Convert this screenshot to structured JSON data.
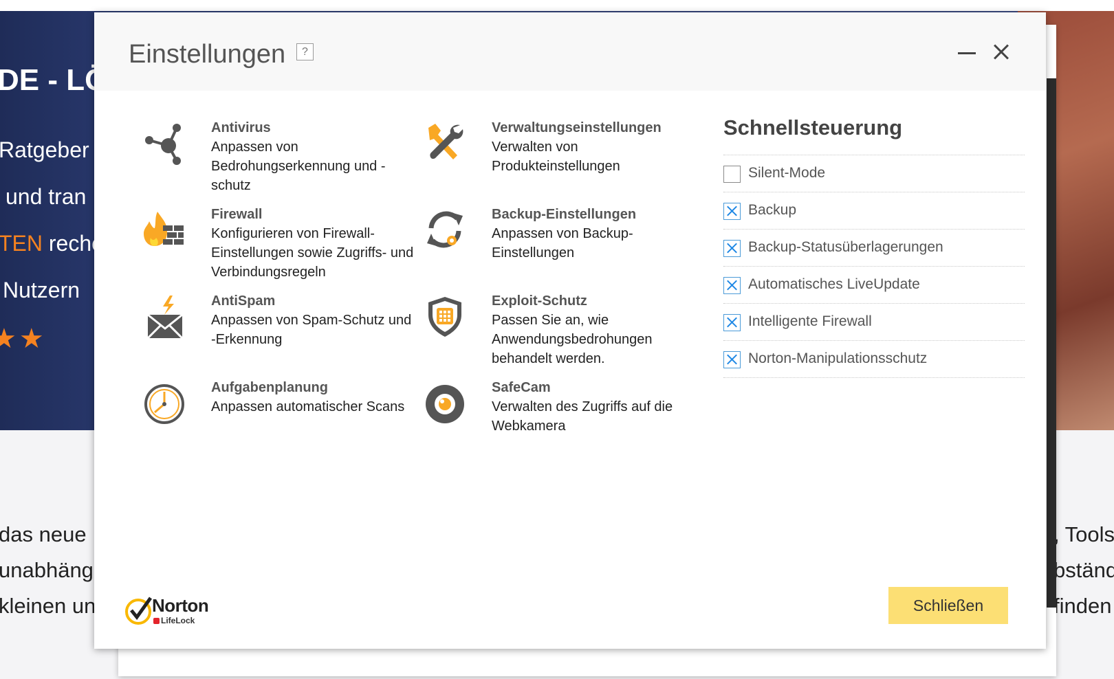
{
  "background": {
    "hero_title": "DE - LÖ",
    "hero_line1": "Ratgeber",
    "hero_line2": "und tran",
    "hero_line3_accent": "TEN",
    "hero_line3_rest": " reche",
    "hero_line4": "Nutzern",
    "stars": "★★",
    "body_left": [
      "das neue I",
      "unabhängi",
      "kleinen un"
    ],
    "body_right": [
      ", Tools",
      "bständ",
      "finden"
    ]
  },
  "dialog": {
    "title": "Einstellungen",
    "help_label": "?",
    "minimize_label": "",
    "close_label": ""
  },
  "settings": [
    {
      "title": "Antivirus",
      "description": "Anpassen von Bedrohungserkennung und -schutz",
      "icon": "antivirus-icon"
    },
    {
      "title": "Firewall",
      "description": "Konfigurieren von Firewall-Einstellungen sowie Zugriffs- und Verbindungsregeln",
      "icon": "firewall-icon"
    },
    {
      "title": "AntiSpam",
      "description": "Anpassen von Spam-Schutz und -Erkennung",
      "icon": "antispam-icon"
    },
    {
      "title": "Aufgabenplanung",
      "description": "Anpassen automatischer Scans",
      "icon": "clock-icon"
    },
    {
      "title": "Verwaltungseinstellungen",
      "description": "Verwalten von Produkteinstellungen",
      "icon": "tools-icon"
    },
    {
      "title": "Backup-Einstellungen",
      "description": "Anpassen von Backup-Einstellungen",
      "icon": "backup-icon"
    },
    {
      "title": "Exploit-Schutz",
      "description": "Passen Sie an, wie Anwendungsbedrohungen behandelt werden.",
      "icon": "shield-icon"
    },
    {
      "title": "SafeCam",
      "description": "Verwalten des Zugriffs auf die Webkamera",
      "icon": "webcam-icon"
    }
  ],
  "quick_controls": {
    "title": "Schnellsteuerung",
    "items": [
      {
        "label": "Silent-Mode",
        "checked": false
      },
      {
        "label": "Backup",
        "checked": true
      },
      {
        "label": "Backup-Statusüberlagerungen",
        "checked": true
      },
      {
        "label": "Automatisches LiveUpdate",
        "checked": true
      },
      {
        "label": "Intelligente Firewall",
        "checked": true
      },
      {
        "label": "Norton-Manipulationsschutz",
        "checked": true
      }
    ]
  },
  "footer": {
    "close_button_label": "Schließen",
    "brand_name": "Norton",
    "brand_sub": "LifeLock"
  },
  "colors": {
    "accent_yellow": "#fcdf74",
    "checkbox_blue": "#1e88e5",
    "icon_gray": "#555555",
    "icon_orange": "#f9a825"
  }
}
